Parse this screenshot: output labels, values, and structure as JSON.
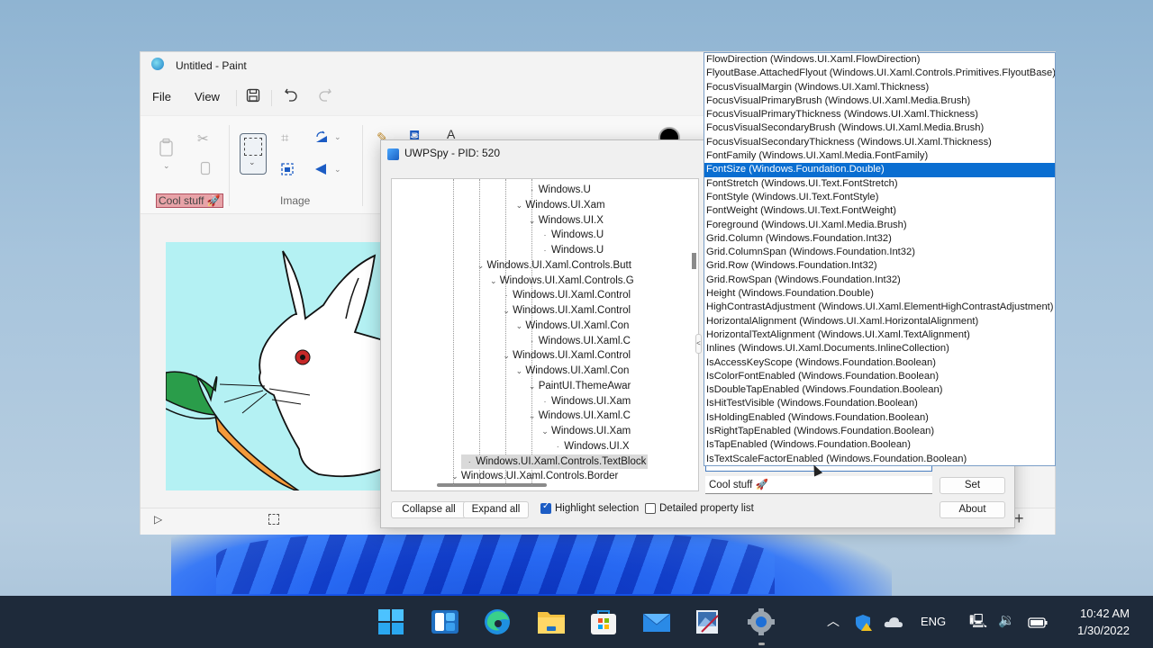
{
  "paint": {
    "title": "Untitled - Paint",
    "menu": {
      "file": "File",
      "view": "View"
    },
    "toolbar": {
      "save_icon": "save-icon",
      "undo_icon": "undo-icon",
      "redo_icon": "redo-icon"
    },
    "ribbon": {
      "clipboard_label": "Cool stuff 🚀",
      "image_label": "Image"
    },
    "canvas": {
      "description": "White rabbit sniffing an orange carrot on a light cyan background",
      "background": "#b4f1f3"
    }
  },
  "uwpspy": {
    "title": "UWPSpy - PID: 520",
    "tree": [
      {
        "text": "Windows.U",
        "level": 9,
        "caret": false
      },
      {
        "text": "Windows.UI.Xam",
        "level": 8,
        "caret": true
      },
      {
        "text": "Windows.UI.X",
        "level": 9,
        "caret": true
      },
      {
        "text": "Windows.U",
        "level": 10,
        "caret": false
      },
      {
        "text": "Windows.U",
        "level": 10,
        "caret": false
      },
      {
        "text": "Windows.UI.Xaml.Controls.Butt",
        "level": 5,
        "caret": true
      },
      {
        "text": "Windows.UI.Xaml.Controls.G",
        "level": 6,
        "caret": true
      },
      {
        "text": "Windows.UI.Xaml.Control",
        "level": 7,
        "caret": false
      },
      {
        "text": "Windows.UI.Xaml.Control",
        "level": 7,
        "caret": true
      },
      {
        "text": "Windows.UI.Xaml.Con",
        "level": 8,
        "caret": true
      },
      {
        "text": "Windows.UI.Xaml.C",
        "level": 9,
        "caret": false
      },
      {
        "text": "Windows.UI.Xaml.Control",
        "level": 7,
        "caret": true
      },
      {
        "text": "Windows.UI.Xaml.Con",
        "level": 8,
        "caret": true
      },
      {
        "text": "PaintUI.ThemeAwar",
        "level": 9,
        "caret": true
      },
      {
        "text": "Windows.UI.Xam",
        "level": 10,
        "caret": false
      },
      {
        "text": "Windows.UI.Xaml.C",
        "level": 9,
        "caret": true
      },
      {
        "text": "Windows.UI.Xam",
        "level": 10,
        "caret": true
      },
      {
        "text": "Windows.UI.X",
        "level": 11,
        "caret": false
      },
      {
        "text": "Windows.UI.Xaml.Controls.TextBlock",
        "level": 4,
        "caret": false,
        "selected": true
      },
      {
        "text": "Windows.UI.Xaml.Controls.Border",
        "level": 3,
        "caret": true
      }
    ],
    "buttons": {
      "collapse_all": "Collapse all",
      "expand_all": "Expand all",
      "set": "Set",
      "about": "About"
    },
    "checkboxes": {
      "highlight_selection": {
        "label": "Highlight selection",
        "checked": true
      },
      "detailed_property_list": {
        "label": "Detailed property list",
        "checked": false
      }
    },
    "property_value": "Cool stuff 🚀",
    "splitter_glyph": "<"
  },
  "property_dropdown": {
    "selected": "FontSize (Windows.Foundation.Double)",
    "items": [
      "FlowDirection (Windows.UI.Xaml.FlowDirection)",
      "FlyoutBase.AttachedFlyout (Windows.UI.Xaml.Controls.Primitives.FlyoutBase)",
      "FocusVisualMargin (Windows.UI.Xaml.Thickness)",
      "FocusVisualPrimaryBrush (Windows.UI.Xaml.Media.Brush)",
      "FocusVisualPrimaryThickness (Windows.UI.Xaml.Thickness)",
      "FocusVisualSecondaryBrush (Windows.UI.Xaml.Media.Brush)",
      "FocusVisualSecondaryThickness (Windows.UI.Xaml.Thickness)",
      "FontFamily (Windows.UI.Xaml.Media.FontFamily)",
      "FontSize (Windows.Foundation.Double)",
      "FontStretch (Windows.UI.Text.FontStretch)",
      "FontStyle (Windows.UI.Text.FontStyle)",
      "FontWeight (Windows.UI.Text.FontWeight)",
      "Foreground (Windows.UI.Xaml.Media.Brush)",
      "Grid.Column (Windows.Foundation.Int32)",
      "Grid.ColumnSpan (Windows.Foundation.Int32)",
      "Grid.Row (Windows.Foundation.Int32)",
      "Grid.RowSpan (Windows.Foundation.Int32)",
      "Height (Windows.Foundation.Double)",
      "HighContrastAdjustment (Windows.UI.Xaml.ElementHighContrastAdjustment)",
      "HorizontalAlignment (Windows.UI.Xaml.HorizontalAlignment)",
      "HorizontalTextAlignment (Windows.UI.Xaml.TextAlignment)",
      "Inlines (Windows.UI.Xaml.Documents.InlineCollection)",
      "IsAccessKeyScope (Windows.Foundation.Boolean)",
      "IsColorFontEnabled (Windows.Foundation.Boolean)",
      "IsDoubleTapEnabled (Windows.Foundation.Boolean)",
      "IsHitTestVisible (Windows.Foundation.Boolean)",
      "IsHoldingEnabled (Windows.Foundation.Boolean)",
      "IsRightTapEnabled (Windows.Foundation.Boolean)",
      "IsTapEnabled (Windows.Foundation.Boolean)",
      "IsTextScaleFactorEnabled (Windows.Foundation.Boolean)"
    ]
  },
  "taskbar": {
    "pinned": [
      "start-icon",
      "widgets-icon",
      "edge-icon",
      "file-explorer-icon",
      "store-icon",
      "mail-icon",
      "paint-icon",
      "settings-icon"
    ],
    "language": "ENG",
    "time": "10:42 AM",
    "date": "1/30/2022"
  },
  "colors": {
    "accent": "#0a6ed1",
    "taskbar": "#1e2a3a",
    "canvas_bg": "#b4f1f3",
    "label_highlight": "#e8a3a8"
  }
}
